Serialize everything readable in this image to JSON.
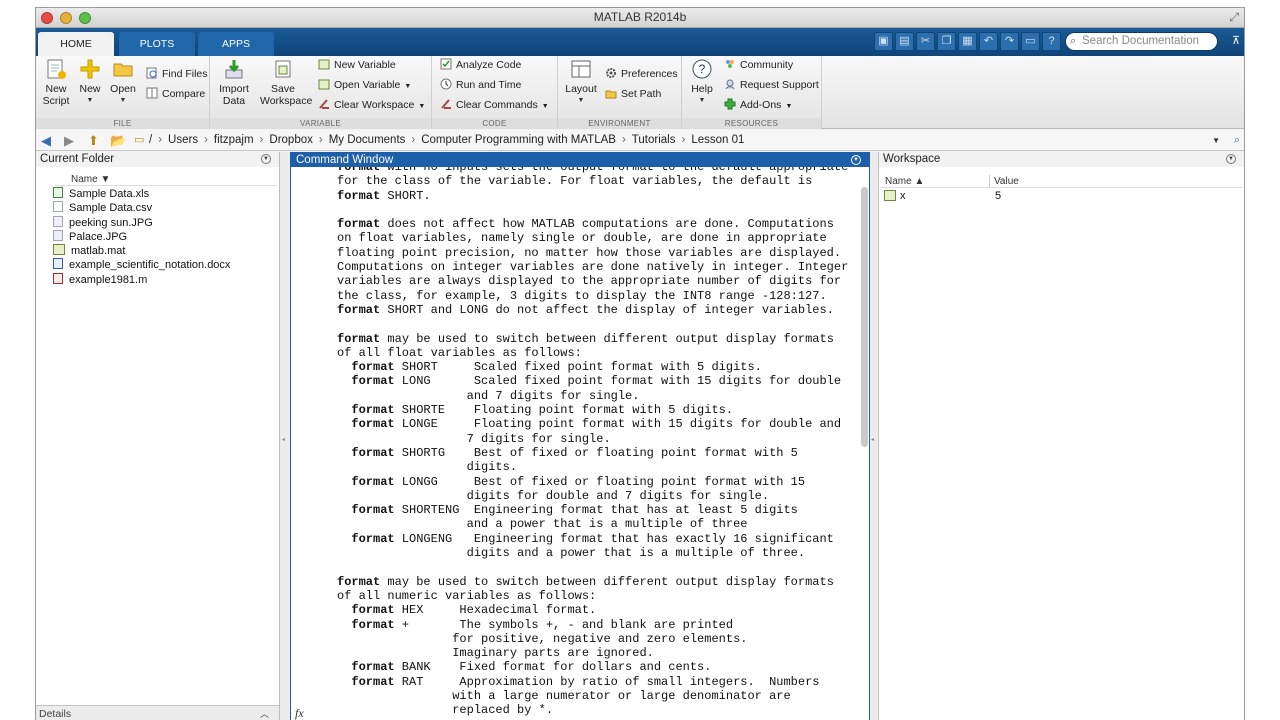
{
  "window": {
    "title": "MATLAB R2014b"
  },
  "tabs": [
    {
      "label": "HOME",
      "active": true
    },
    {
      "label": "PLOTS",
      "active": false
    },
    {
      "label": "APPS",
      "active": false
    }
  ],
  "search": {
    "placeholder": "Search Documentation"
  },
  "ribbon": {
    "file": {
      "label": "FILE",
      "new_script": [
        "New",
        "Script"
      ],
      "new": "New",
      "open": "Open",
      "find_files": "Find Files",
      "compare": "Compare"
    },
    "variable": {
      "label": "VARIABLE",
      "import_data": [
        "Import",
        "Data"
      ],
      "save_workspace": [
        "Save",
        "Workspace"
      ],
      "new_variable": "New Variable",
      "open_variable": "Open Variable",
      "clear_workspace": "Clear Workspace"
    },
    "code": {
      "label": "CODE",
      "analyze_code": "Analyze Code",
      "run_and_time": "Run and Time",
      "clear_commands": "Clear Commands"
    },
    "environment": {
      "label": "ENVIRONMENT",
      "layout": "Layout",
      "preferences": "Preferences",
      "set_path": "Set Path"
    },
    "resources": {
      "label": "RESOURCES",
      "help": "Help",
      "community": "Community",
      "request_support": "Request Support",
      "add_ons": "Add-Ons"
    }
  },
  "address": {
    "crumbs": [
      "/",
      "Users",
      "fitzpajm",
      "Dropbox",
      "My Documents",
      "Computer Programming with MATLAB",
      "Tutorials",
      "Lesson 01"
    ]
  },
  "current_folder": {
    "title": "Current Folder",
    "column_name": "Name ▼",
    "files": [
      {
        "name": "Sample Data.xls",
        "icon": "excel-file-icon"
      },
      {
        "name": "Sample Data.csv",
        "icon": "csv-file-icon"
      },
      {
        "name": "peeking sun.JPG",
        "icon": "image-file-icon"
      },
      {
        "name": "Palace.JPG",
        "icon": "image-file-icon"
      },
      {
        "name": "matlab.mat",
        "icon": "mat-file-icon"
      },
      {
        "name": "example_scientific_notation.docx",
        "icon": "word-file-icon"
      },
      {
        "name": "example1981.m",
        "icon": "m-file-icon"
      }
    ],
    "details": "Details"
  },
  "command_window": {
    "title": "Command Window",
    "lines": [
      [
        "format",
        " with no inputs sets the output format to the default appropriate"
      ],
      [
        "",
        "for the class of the variable. For float variables, the default is"
      ],
      [
        "format",
        " SHORT."
      ],
      [
        "",
        ""
      ],
      [
        "format",
        " does not affect how MATLAB computations are done. Computations"
      ],
      [
        "",
        "on float variables, namely single or double, are done in appropriate"
      ],
      [
        "",
        "floating point precision, no matter how those variables are displayed."
      ],
      [
        "",
        "Computations on integer variables are done natively in integer. Integer"
      ],
      [
        "",
        "variables are always displayed to the appropriate number of digits for"
      ],
      [
        "",
        "the class, for example, 3 digits to display the INT8 range -128:127."
      ],
      [
        "format",
        " SHORT and LONG do not affect the display of integer variables."
      ],
      [
        "",
        ""
      ],
      [
        "format",
        " may be used to switch between different output display formats"
      ],
      [
        "",
        "of all float variables as follows:"
      ],
      [
        "  format",
        " SHORT     Scaled fixed point format with 5 digits."
      ],
      [
        "  format",
        " LONG      Scaled fixed point format with 15 digits for double"
      ],
      [
        "",
        "                  and 7 digits for single."
      ],
      [
        "  format",
        " SHORTE    Floating point format with 5 digits."
      ],
      [
        "  format",
        " LONGE     Floating point format with 15 digits for double and"
      ],
      [
        "",
        "                  7 digits for single."
      ],
      [
        "  format",
        " SHORTG    Best of fixed or floating point format with 5"
      ],
      [
        "",
        "                  digits."
      ],
      [
        "  format",
        " LONGG     Best of fixed or floating point format with 15"
      ],
      [
        "",
        "                  digits for double and 7 digits for single."
      ],
      [
        "  format",
        " SHORTENG  Engineering format that has at least 5 digits"
      ],
      [
        "",
        "                  and a power that is a multiple of three"
      ],
      [
        "  format",
        " LONGENG   Engineering format that has exactly 16 significant"
      ],
      [
        "",
        "                  digits and a power that is a multiple of three."
      ],
      [
        "",
        ""
      ],
      [
        "format",
        " may be used to switch between different output display formats"
      ],
      [
        "",
        "of all numeric variables as follows:"
      ],
      [
        "  format",
        " HEX     Hexadecimal format."
      ],
      [
        "  format",
        " +       The symbols +, - and blank are printed"
      ],
      [
        "",
        "                for positive, negative and zero elements."
      ],
      [
        "",
        "                Imaginary parts are ignored."
      ],
      [
        "  format",
        " BANK    Fixed format for dollars and cents."
      ],
      [
        "  format",
        " RAT     Approximation by ratio of small integers.  Numbers"
      ],
      [
        "",
        "                with a large numerator or large denominator are"
      ],
      [
        "",
        "                replaced by *."
      ]
    ],
    "prompt_icon": "fx"
  },
  "workspace": {
    "title": "Workspace",
    "col_name": "Name ▲",
    "col_value": "Value",
    "vars": [
      {
        "name": "x",
        "value": "5"
      }
    ]
  }
}
